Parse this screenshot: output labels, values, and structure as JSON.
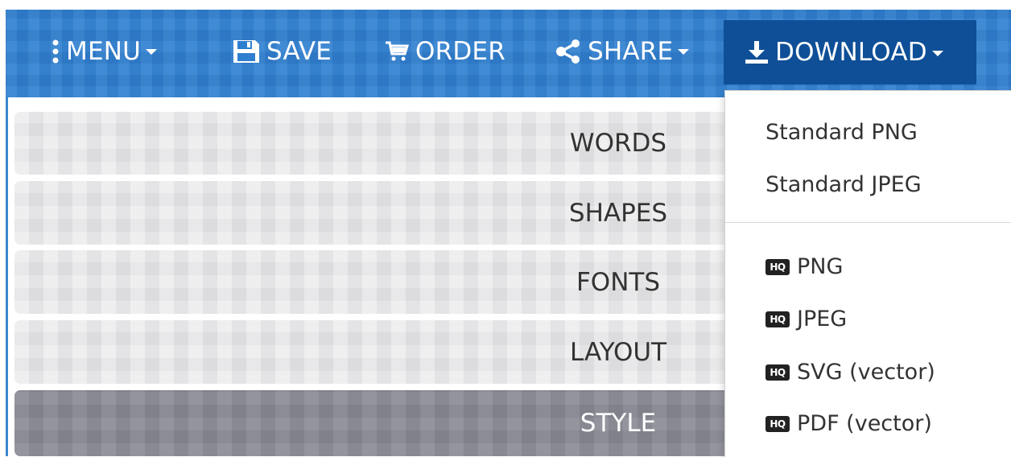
{
  "toolbar": {
    "menu_label": "MENU",
    "save_label": "SAVE",
    "order_label": "ORDER",
    "share_label": "SHARE",
    "download_label": "DOWNLOAD"
  },
  "panels": [
    {
      "label": "WORDS"
    },
    {
      "label": "SHAPES"
    },
    {
      "label": "FONTS"
    },
    {
      "label": "LAYOUT"
    },
    {
      "label": "STYLE"
    }
  ],
  "download_menu": {
    "standard_items": [
      "Standard PNG",
      "Standard JPEG"
    ],
    "hq_badge": "HQ",
    "hq_items": [
      "PNG",
      "JPEG",
      "SVG (vector)",
      "PDF (vector)"
    ]
  },
  "colors": {
    "navbar": "#2f7fd0",
    "download_active": "#0e4f97",
    "panel": "#e5e5e7",
    "panel_active": "#898a94"
  }
}
